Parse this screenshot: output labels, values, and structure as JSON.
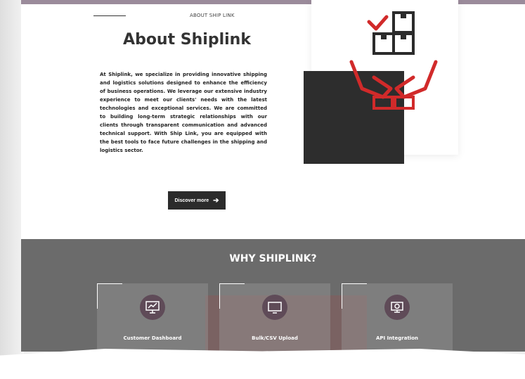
{
  "about": {
    "eyebrow": "ABOUT SHIP LINK",
    "title": "About Shiplink",
    "body": "At Shiplink, we specialize in providing innovative shipping and logistics solutions designed to enhance the efficiency of business operations. We leverage our extensive industry experience to meet our clients' needs with the latest technologies and exceptional services. We are committed to building long-term strategic relationships with our clients through transparent communication and advanced technical support. With Ship Link, you are equipped with the best tools to face future challenges in the shipping and logistics sector.",
    "cta_label": "Discover more"
  },
  "why": {
    "title": "WHY SHIPLINK?",
    "features": [
      {
        "label": "Customer Dashboard",
        "icon": "dashboard-monitor-icon"
      },
      {
        "label": "Bulk/CSV Upload",
        "icon": "monitor-icon"
      },
      {
        "label": "API Integration",
        "icon": "api-gear-monitor-icon"
      }
    ]
  },
  "colors": {
    "accent_red": "#d12a2a",
    "dark": "#2b2b2b",
    "section_bg": "#6b6b6b",
    "icon_circle": "#5f4b58"
  },
  "icons": {
    "hero": "hands-holding-boxes-icon",
    "cta_arrow": "arrow-right-icon"
  }
}
